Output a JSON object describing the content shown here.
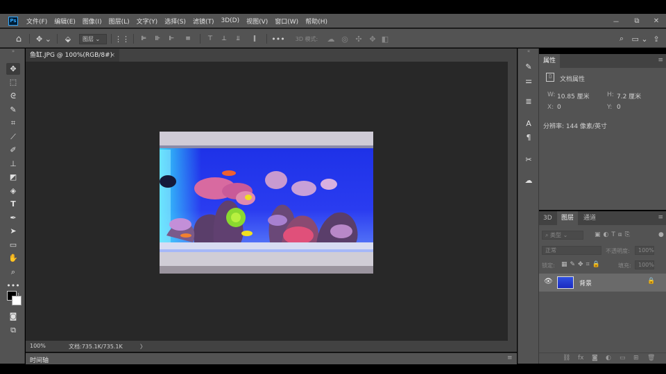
{
  "app": {
    "logo": "Ps"
  },
  "menu": [
    "文件(F)",
    "编辑(E)",
    "图像(I)",
    "图层(L)",
    "文字(Y)",
    "选择(S)",
    "滤镜(T)",
    "3D(D)",
    "视图(V)",
    "窗口(W)",
    "帮助(H)"
  ],
  "window_controls": {
    "minimize": "－",
    "restore": "⧉",
    "close": "✕"
  },
  "options": {
    "layer_select": "图层",
    "mode_3d": "3D 模式:"
  },
  "document": {
    "tab_title": "鱼缸.JPG @ 100%(RGB/8#)",
    "close": "×"
  },
  "status": {
    "zoom": "100%",
    "doc_info": "文档:735.1K/735.1K",
    "arrow": "〉"
  },
  "timeline": {
    "label": "时间轴"
  },
  "properties": {
    "tab": "属性",
    "section": "文档属性",
    "w_label": "W:",
    "w_value": "10.85 厘米",
    "h_label": "H:",
    "h_value": "7.2 厘米",
    "x_label": "X:",
    "x_value": "0",
    "y_label": "Y:",
    "y_value": "0",
    "resolution": "分辨率: 144 像素/英寸"
  },
  "layers": {
    "tabs": [
      "3D",
      "图层",
      "通道"
    ],
    "filter_placeholder": "类型",
    "blend_mode": "正常",
    "opacity_label": "不透明度:",
    "opacity_value": "100%",
    "lock_label": "锁定:",
    "fill_label": "填充:",
    "fill_value": "100%",
    "layer_name": "背景"
  },
  "colors": {
    "panel": "#535353",
    "dark": "#424242",
    "canvas": "#282828",
    "accent": "#31a8ff"
  }
}
